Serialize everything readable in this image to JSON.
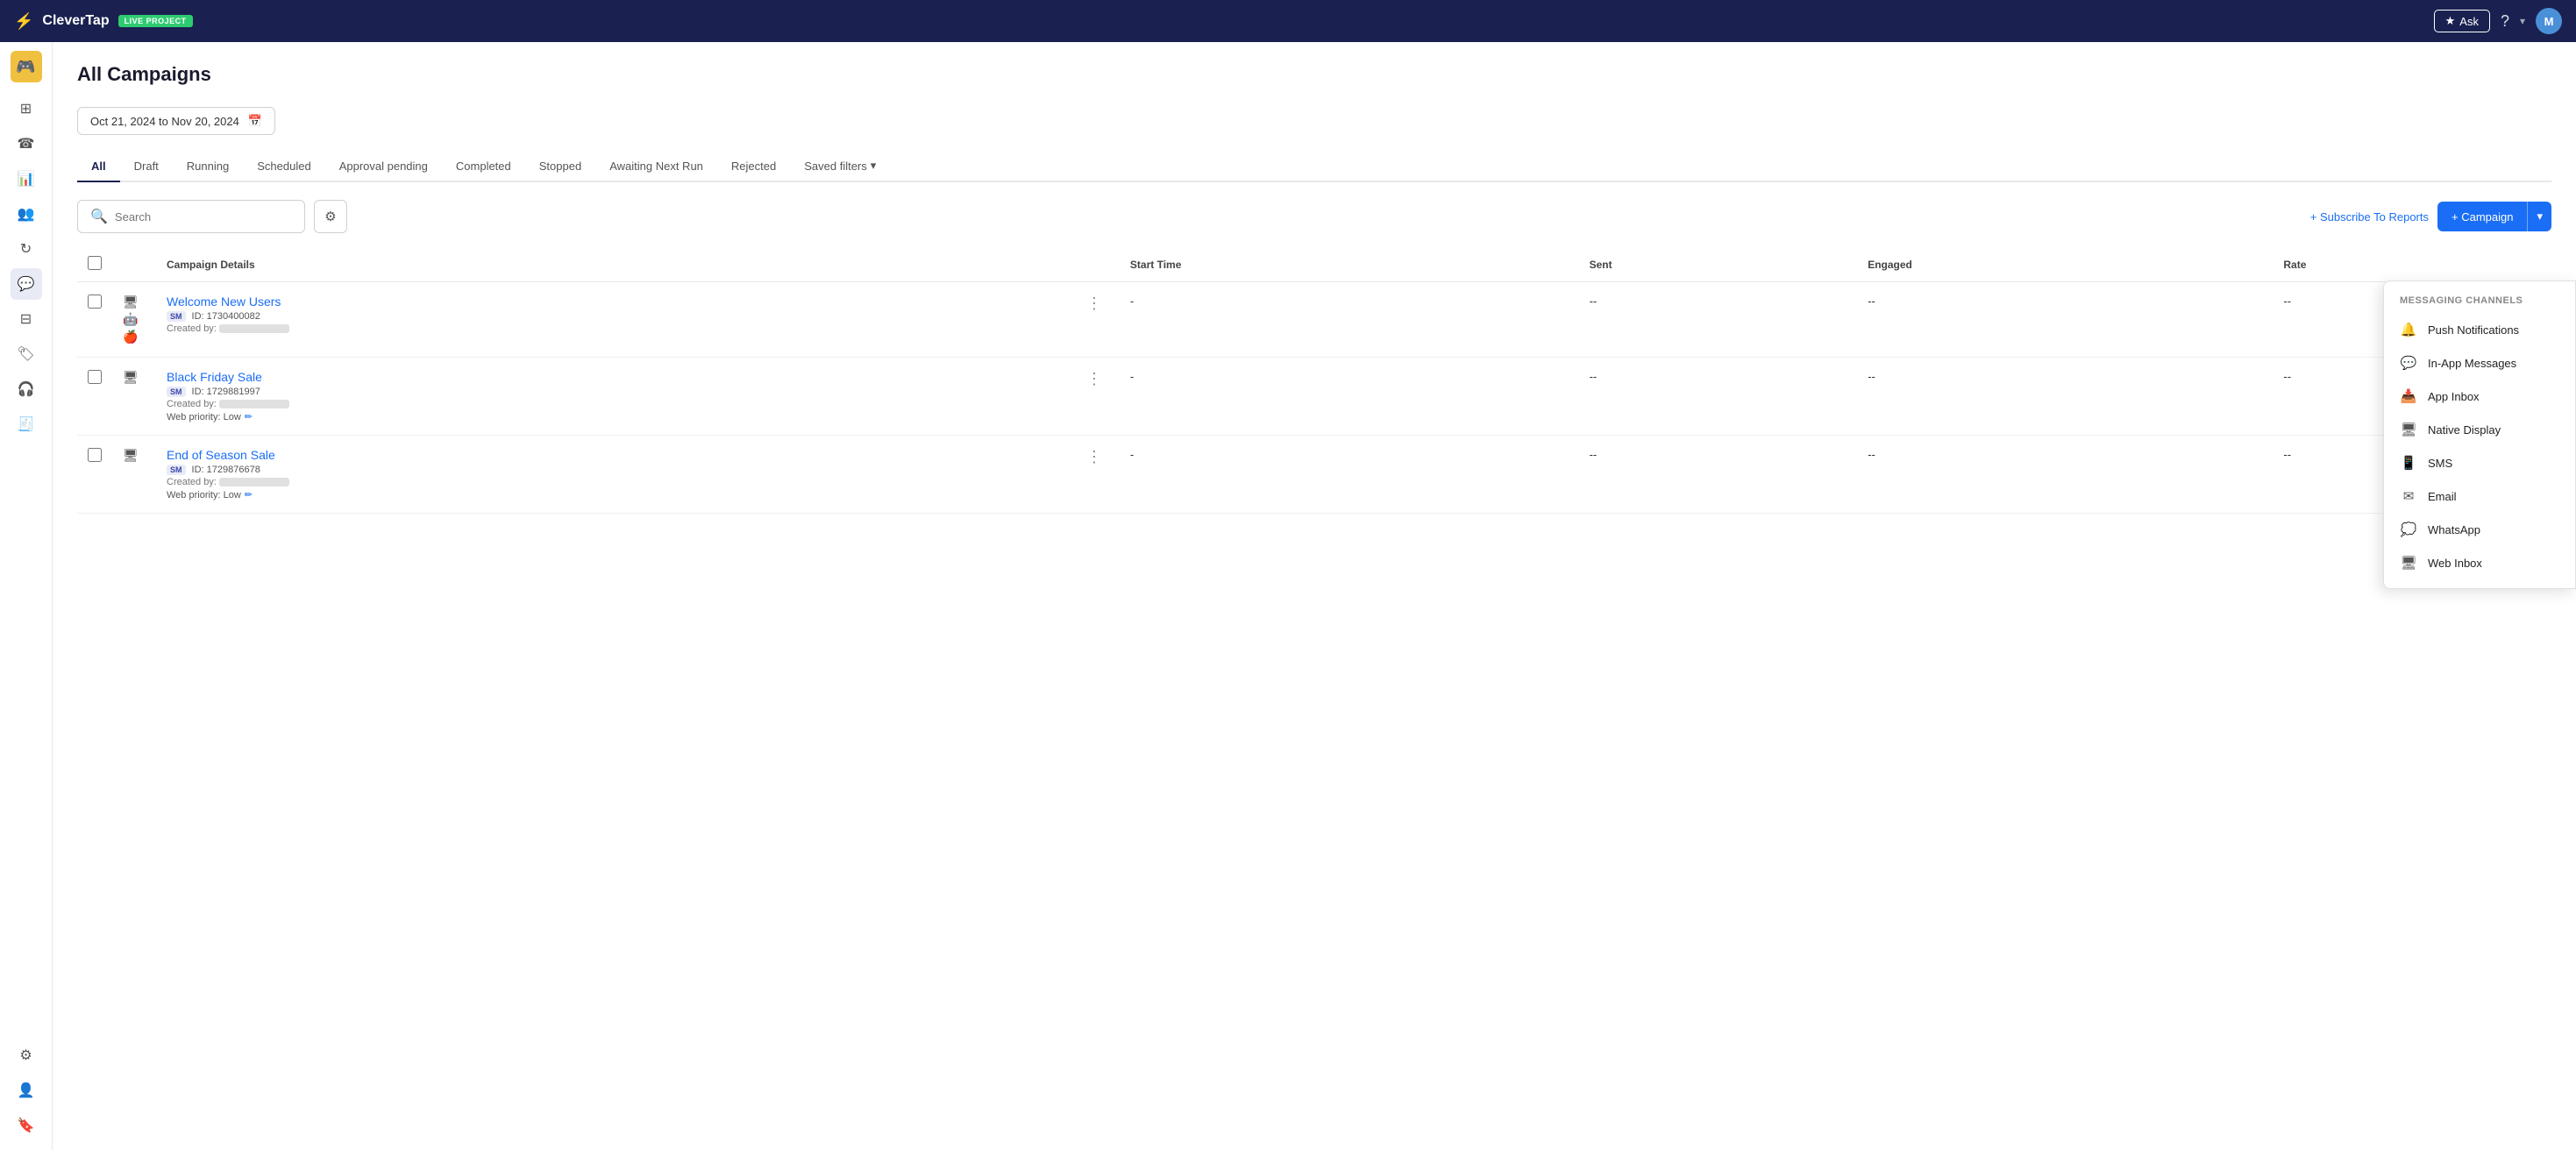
{
  "header": {
    "logo_text": "CleverTap",
    "live_badge": "LIVE PROJECT",
    "ask_label": "Ask",
    "help_icon": "?",
    "avatar_label": "M"
  },
  "page": {
    "title": "All Campaigns"
  },
  "date_filter": {
    "label": "Oct 21, 2024 to Nov 20, 2024"
  },
  "tabs": [
    {
      "label": "All",
      "active": true
    },
    {
      "label": "Draft",
      "active": false
    },
    {
      "label": "Running",
      "active": false
    },
    {
      "label": "Scheduled",
      "active": false
    },
    {
      "label": "Approval pending",
      "active": false
    },
    {
      "label": "Completed",
      "active": false
    },
    {
      "label": "Stopped",
      "active": false
    },
    {
      "label": "Awaiting Next Run",
      "active": false
    },
    {
      "label": "Rejected",
      "active": false
    },
    {
      "label": "Saved filters",
      "active": false
    }
  ],
  "search": {
    "placeholder": "Search"
  },
  "actions": {
    "subscribe_label": "+ Subscribe To Reports",
    "campaign_label": "+ Campaign"
  },
  "table": {
    "columns": [
      "",
      "",
      "Campaign Details",
      "",
      "Start Time",
      "Sent",
      "Engaged",
      "Rate",
      ""
    ],
    "rows": [
      {
        "name": "Welcome New Users",
        "id": "ID: 1730400082",
        "created_by": "Created by:",
        "web_priority": null,
        "start_time": "-",
        "sent": "--",
        "engaged": "--",
        "rate": "--",
        "channels": [
          "monitor",
          "android",
          "apple"
        ]
      },
      {
        "name": "Black Friday Sale",
        "id": "ID: 1729881997",
        "created_by": "Created by:",
        "web_priority": "Web priority: Low",
        "start_time": "-",
        "sent": "--",
        "engaged": "--",
        "rate": "--",
        "channels": [
          "monitor"
        ]
      },
      {
        "name": "End of Season Sale",
        "id": "ID: 1729876678",
        "created_by": "Created by:",
        "web_priority": "Web priority: Low",
        "start_time": "-",
        "sent": "--",
        "engaged": "--",
        "rate": "--",
        "channels": [
          "monitor"
        ]
      }
    ]
  },
  "dropdown": {
    "header": "Messaging Channels",
    "items": [
      {
        "label": "Push Notifications",
        "icon": "🔔"
      },
      {
        "label": "In-App Messages",
        "icon": "💬"
      },
      {
        "label": "App Inbox",
        "icon": "📥"
      },
      {
        "label": "Native Display",
        "icon": "🖥"
      },
      {
        "label": "SMS",
        "icon": "📱"
      },
      {
        "label": "Email",
        "icon": "✉"
      },
      {
        "label": "WhatsApp",
        "icon": "💭"
      },
      {
        "label": "Web Inbox",
        "icon": "🖥"
      }
    ]
  },
  "sidebar": {
    "icons": [
      {
        "name": "dashboard-icon",
        "symbol": "⊞",
        "active": false
      },
      {
        "name": "phone-icon",
        "symbol": "📞",
        "active": false
      },
      {
        "name": "chart-icon",
        "symbol": "📊",
        "active": false
      },
      {
        "name": "users-icon",
        "symbol": "👥",
        "active": false
      },
      {
        "name": "refresh-icon",
        "symbol": "🔄",
        "active": false
      },
      {
        "name": "chat-icon",
        "symbol": "💬",
        "active": true
      },
      {
        "name": "layout-icon",
        "symbol": "⊟",
        "active": false
      },
      {
        "name": "tag-icon",
        "symbol": "🏷",
        "active": false
      },
      {
        "name": "support-icon",
        "symbol": "🎧",
        "active": false
      },
      {
        "name": "receipt-icon",
        "symbol": "🧾",
        "active": false
      }
    ],
    "bottom_icons": [
      {
        "name": "settings-icon",
        "symbol": "⚙",
        "active": false
      },
      {
        "name": "people-icon",
        "symbol": "👤",
        "active": false
      },
      {
        "name": "bookmark-icon",
        "symbol": "🔖",
        "active": false
      }
    ]
  }
}
